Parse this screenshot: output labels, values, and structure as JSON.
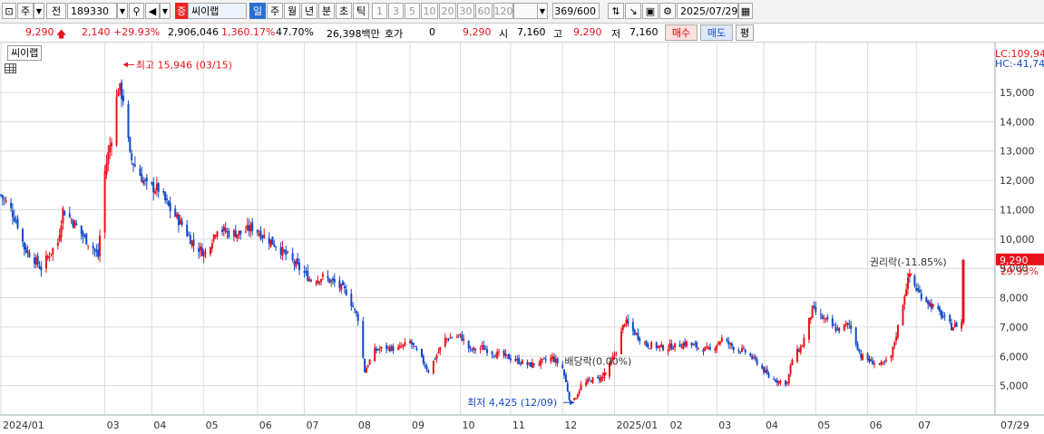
{
  "toolbar": {
    "type_label": "주",
    "period_label": "전",
    "code": "189330",
    "badge": "증",
    "name": "씨이랩",
    "periods": [
      "일",
      "주",
      "월",
      "년",
      "분",
      "초",
      "틱"
    ],
    "selected_period": "일",
    "minutes": [
      "1",
      "3",
      "5",
      "10",
      "20",
      "30",
      "60",
      "120"
    ],
    "count": "369",
    "count_total": "/600",
    "date": "2025/07/29"
  },
  "quote": {
    "price": "9,290",
    "change": "2,140",
    "change_pct": "+29.93%",
    "volume": "2,906,046",
    "volume_pct": "1,360.17%",
    "turnover": "47.70%",
    "amount": "26,398백만",
    "hoga_label": "호가",
    "hoga_value": "0",
    "hoga_price": "9,290",
    "open_label": "시",
    "open": "7,160",
    "high_label": "고",
    "high": "9,290",
    "low_label": "저",
    "low": "7,160",
    "buy": "매수",
    "sell": "매도",
    "avg": "평"
  },
  "colors": {
    "up": "#e8121a",
    "down": "#1449c8",
    "selected_tab": "#2d6fcf"
  },
  "chart_data": {
    "type": "candlestick",
    "stock_label": "씨이랩",
    "y_ticks": [
      5000,
      6000,
      7000,
      8000,
      9000,
      10000,
      11000,
      12000,
      13000,
      14000,
      15000
    ],
    "ylim": [
      4000,
      16700
    ],
    "x_ticks": [
      {
        "label": "2024/01",
        "date": "2024-01-02"
      },
      {
        "label": "03",
        "date": "2024-03-04"
      },
      {
        "label": "04",
        "date": "2024-04-01"
      },
      {
        "label": "05",
        "date": "2024-05-02"
      },
      {
        "label": "06",
        "date": "2024-06-03"
      },
      {
        "label": "07",
        "date": "2024-07-01"
      },
      {
        "label": "08",
        "date": "2024-08-01"
      },
      {
        "label": "09",
        "date": "2024-09-02"
      },
      {
        "label": "10",
        "date": "2024-10-02"
      },
      {
        "label": "11",
        "date": "2024-11-01"
      },
      {
        "label": "12",
        "date": "2024-12-02"
      },
      {
        "label": "2025/01",
        "date": "2025-01-02"
      },
      {
        "label": "02",
        "date": "2025-02-03"
      },
      {
        "label": "03",
        "date": "2025-03-04"
      },
      {
        "label": "04",
        "date": "2025-04-01"
      },
      {
        "label": "05",
        "date": "2025-05-02"
      },
      {
        "label": "06",
        "date": "2025-06-02"
      },
      {
        "label": "07",
        "date": "2025-07-01"
      }
    ],
    "x_end_label": "07/29",
    "right_labels": {
      "lc": "LC:109,94",
      "hc": "HC:-41,74"
    },
    "current_price": {
      "value": 9290,
      "label": "9,290",
      "pct": "29.93%"
    },
    "annotations": [
      {
        "text": "최고 15,946 (03/15)",
        "value": 15946,
        "date": "2024-03-15",
        "kind": "high"
      },
      {
        "text": "최저 4,425 (12/09)",
        "value": 4425,
        "date": "2024-12-09",
        "kind": "low"
      },
      {
        "text": "배당락(0.00%)",
        "value": 5350,
        "date": "2024-12-27",
        "kind": "event"
      },
      {
        "text": "권리락(-11.85%)",
        "value": 8730,
        "date": "2025-06-27",
        "kind": "event"
      }
    ],
    "close_path": [
      [
        "2024-01-02",
        11500
      ],
      [
        "2024-01-08",
        11000
      ],
      [
        "2024-01-12",
        10500
      ],
      [
        "2024-01-16",
        9700
      ],
      [
        "2024-01-22",
        9300
      ],
      [
        "2024-01-26",
        9000
      ],
      [
        "2024-01-31",
        9500
      ],
      [
        "2024-02-05",
        9900
      ],
      [
        "2024-02-08",
        11000
      ],
      [
        "2024-02-14",
        10600
      ],
      [
        "2024-02-20",
        10100
      ],
      [
        "2024-02-26",
        9700
      ],
      [
        "2024-02-29",
        9400
      ],
      [
        "2024-03-04",
        12300
      ],
      [
        "2024-03-08",
        13500
      ],
      [
        "2024-03-12",
        15200
      ],
      [
        "2024-03-15",
        14800
      ],
      [
        "2024-03-19",
        12800
      ],
      [
        "2024-03-25",
        12200
      ],
      [
        "2024-03-29",
        11800
      ],
      [
        "2024-04-05",
        11700
      ],
      [
        "2024-04-12",
        11000
      ],
      [
        "2024-04-19",
        10500
      ],
      [
        "2024-04-26",
        9800
      ],
      [
        "2024-05-03",
        9500
      ],
      [
        "2024-05-10",
        10400
      ],
      [
        "2024-05-17",
        10200
      ],
      [
        "2024-05-24",
        10200
      ],
      [
        "2024-05-31",
        10400
      ],
      [
        "2024-06-07",
        10100
      ],
      [
        "2024-06-14",
        9800
      ],
      [
        "2024-06-21",
        9400
      ],
      [
        "2024-06-28",
        9000
      ],
      [
        "2024-07-05",
        8600
      ],
      [
        "2024-07-12",
        8700
      ],
      [
        "2024-07-19",
        8500
      ],
      [
        "2024-07-26",
        8200
      ],
      [
        "2024-08-02",
        7300
      ],
      [
        "2024-08-06",
        5500
      ],
      [
        "2024-08-12",
        6200
      ],
      [
        "2024-08-19",
        6300
      ],
      [
        "2024-08-26",
        6250
      ],
      [
        "2024-09-02",
        6500
      ],
      [
        "2024-09-09",
        5900
      ],
      [
        "2024-09-13",
        5500
      ],
      [
        "2024-09-23",
        6600
      ],
      [
        "2024-10-02",
        6700
      ],
      [
        "2024-10-08",
        6200
      ],
      [
        "2024-10-15",
        6300
      ],
      [
        "2024-10-22",
        6100
      ],
      [
        "2024-10-29",
        6000
      ],
      [
        "2024-11-05",
        5850
      ],
      [
        "2024-11-12",
        5700
      ],
      [
        "2024-11-19",
        5800
      ],
      [
        "2024-11-26",
        5950
      ],
      [
        "2024-12-02",
        5600
      ],
      [
        "2024-12-06",
        4600
      ],
      [
        "2024-12-09",
        4500
      ],
      [
        "2024-12-13",
        5000
      ],
      [
        "2024-12-19",
        5200
      ],
      [
        "2024-12-27",
        5300
      ],
      [
        "2025-01-03",
        6200
      ],
      [
        "2025-01-08",
        7200
      ],
      [
        "2025-01-14",
        6800
      ],
      [
        "2025-01-21",
        6400
      ],
      [
        "2025-01-31",
        6300
      ],
      [
        "2025-02-07",
        6350
      ],
      [
        "2025-02-14",
        6450
      ],
      [
        "2025-02-21",
        6300
      ],
      [
        "2025-02-28",
        6200
      ],
      [
        "2025-03-07",
        6600
      ],
      [
        "2025-03-14",
        6300
      ],
      [
        "2025-03-21",
        6150
      ],
      [
        "2025-03-28",
        5800
      ],
      [
        "2025-04-04",
        5300
      ],
      [
        "2025-04-10",
        5150
      ],
      [
        "2025-04-15",
        5100
      ],
      [
        "2025-04-18",
        5900
      ],
      [
        "2025-04-24",
        6400
      ],
      [
        "2025-04-30",
        7600
      ],
      [
        "2025-05-08",
        7200
      ],
      [
        "2025-05-15",
        6900
      ],
      [
        "2025-05-22",
        7100
      ],
      [
        "2025-05-29",
        6000
      ],
      [
        "2025-06-05",
        5800
      ],
      [
        "2025-06-11",
        5700
      ],
      [
        "2025-06-16",
        6000
      ],
      [
        "2025-06-20",
        7000
      ],
      [
        "2025-06-25",
        8400
      ],
      [
        "2025-06-27",
        8700
      ],
      [
        "2025-07-02",
        8200
      ],
      [
        "2025-07-09",
        7800
      ],
      [
        "2025-07-16",
        7400
      ],
      [
        "2025-07-22",
        7000
      ],
      [
        "2025-07-28",
        7150
      ],
      [
        "2025-07-29",
        9290
      ]
    ]
  }
}
